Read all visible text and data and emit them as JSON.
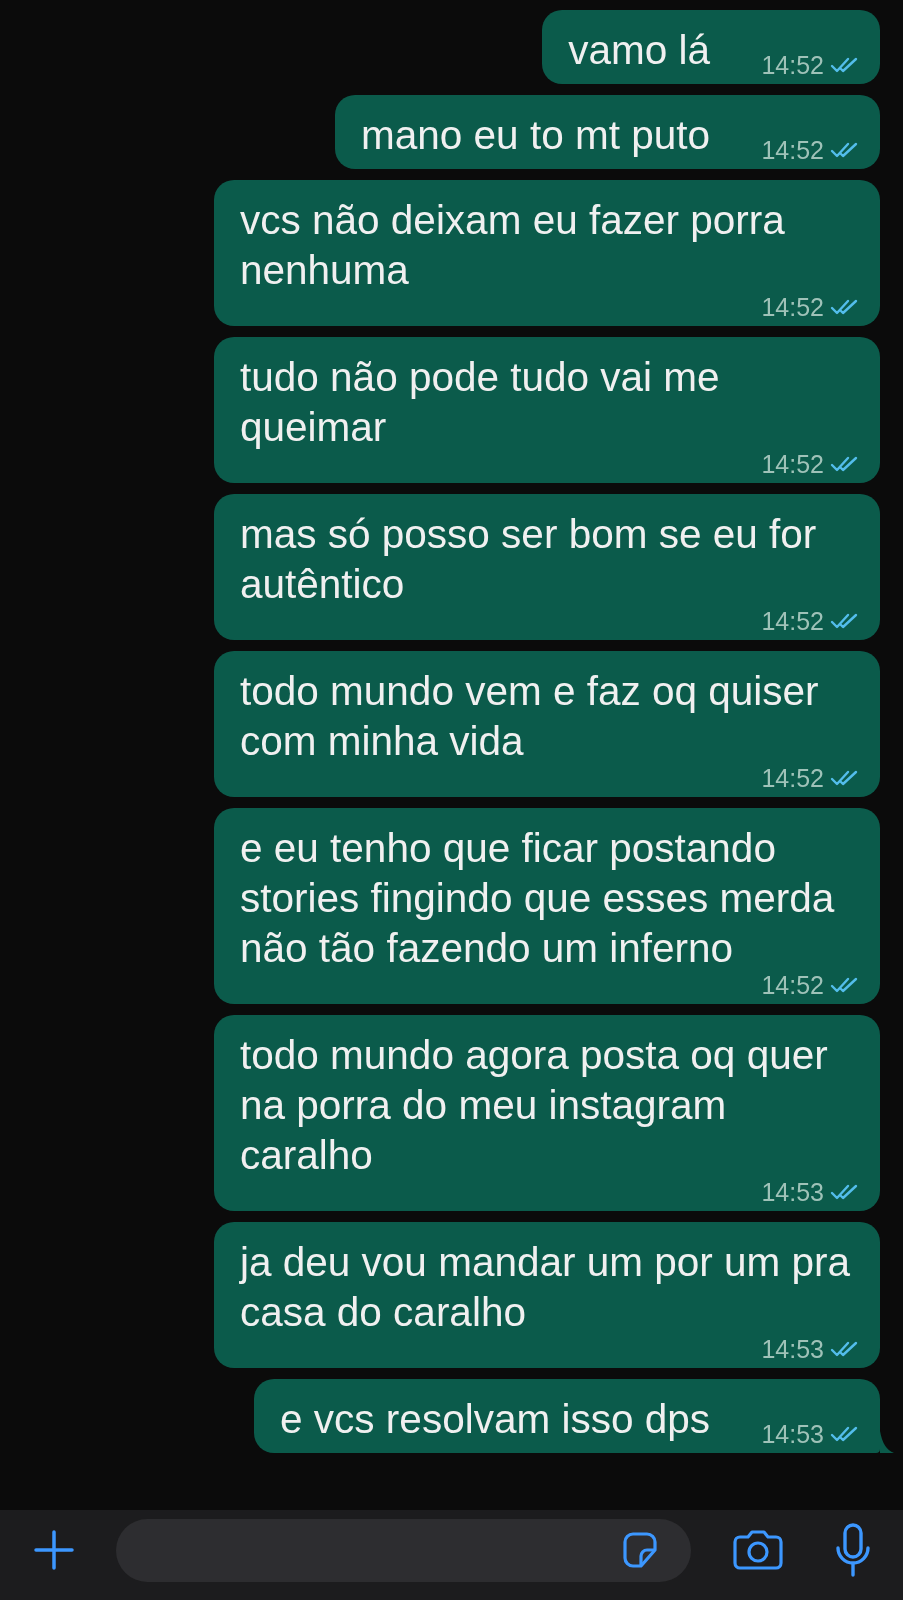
{
  "messages": [
    {
      "text": "vamo lá",
      "time": "14:52",
      "read": true
    },
    {
      "text": "mano eu to mt puto",
      "time": "14:52",
      "read": true
    },
    {
      "text": "vcs não deixam eu fazer porra nenhuma",
      "time": "14:52",
      "read": true
    },
    {
      "text": "tudo não pode tudo vai me queimar",
      "time": "14:52",
      "read": true
    },
    {
      "text": "mas só posso ser bom se eu for autêntico",
      "time": "14:52",
      "read": true
    },
    {
      "text": "todo mundo vem e faz oq quiser com minha vida",
      "time": "14:52",
      "read": true
    },
    {
      "text": "e eu tenho que ficar postando stories fingindo que esses merda não tão fazendo um inferno",
      "time": "14:52",
      "read": true
    },
    {
      "text": "todo mundo agora posta oq quer na porra do meu instagram caralho",
      "time": "14:53",
      "read": true
    },
    {
      "text": "ja deu vou mandar um por um pra casa do caralho",
      "time": "14:53",
      "read": true
    },
    {
      "text": "e vcs resolvam isso dps",
      "time": "14:53",
      "read": true,
      "tail": true
    }
  ]
}
